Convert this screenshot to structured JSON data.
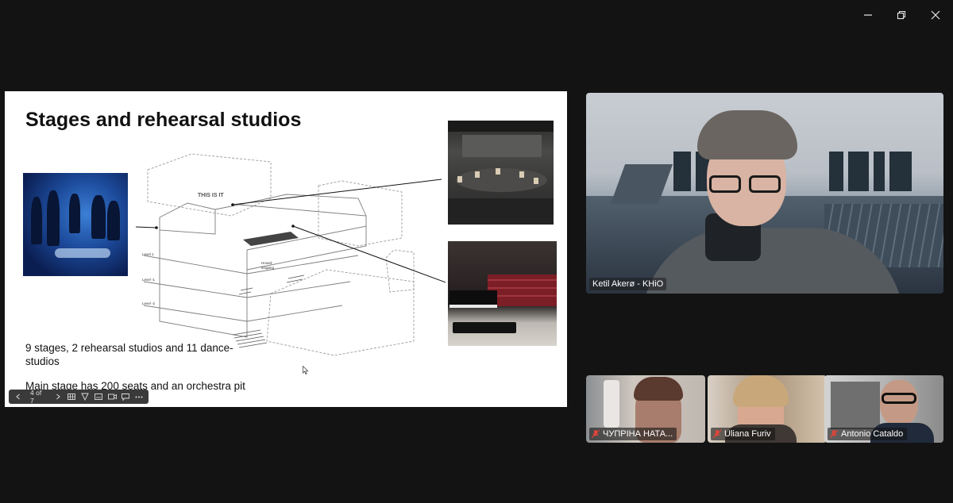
{
  "window": {
    "controls": [
      "minimize-icon",
      "restore-icon",
      "close-icon"
    ]
  },
  "slide": {
    "title": "Stages and rehearsal studios",
    "text1_line1": "9 stages, 2 rehearsal studios and 11 dance-",
    "text1_line2": "studios",
    "text2": "Main stage has 200 seats and an orchestra pit",
    "diagram": {
      "sign": "THIS IS IT",
      "levels": [
        "Level 1",
        "Level -1",
        "Level -2"
      ],
      "entrance_line1": "Hoved-",
      "entrance_line2": "inngang"
    }
  },
  "slide_toolbar": {
    "page_indicator": "4 of 7",
    "buttons": [
      "prev-icon",
      "next-icon",
      "grid-icon",
      "pointer-icon",
      "subtitle-icon",
      "camera-icon",
      "feedback-icon",
      "more-icon"
    ]
  },
  "participants": {
    "main": {
      "name": "Ketil Akerø - KHiO"
    },
    "small": [
      {
        "name": "ЧУПРІНА НАТА..."
      },
      {
        "name": "Uliana Furiv"
      },
      {
        "name": "Antonio Cataldo"
      }
    ]
  },
  "colors": {
    "background": "#131313",
    "mic_off": "#e0453a"
  }
}
